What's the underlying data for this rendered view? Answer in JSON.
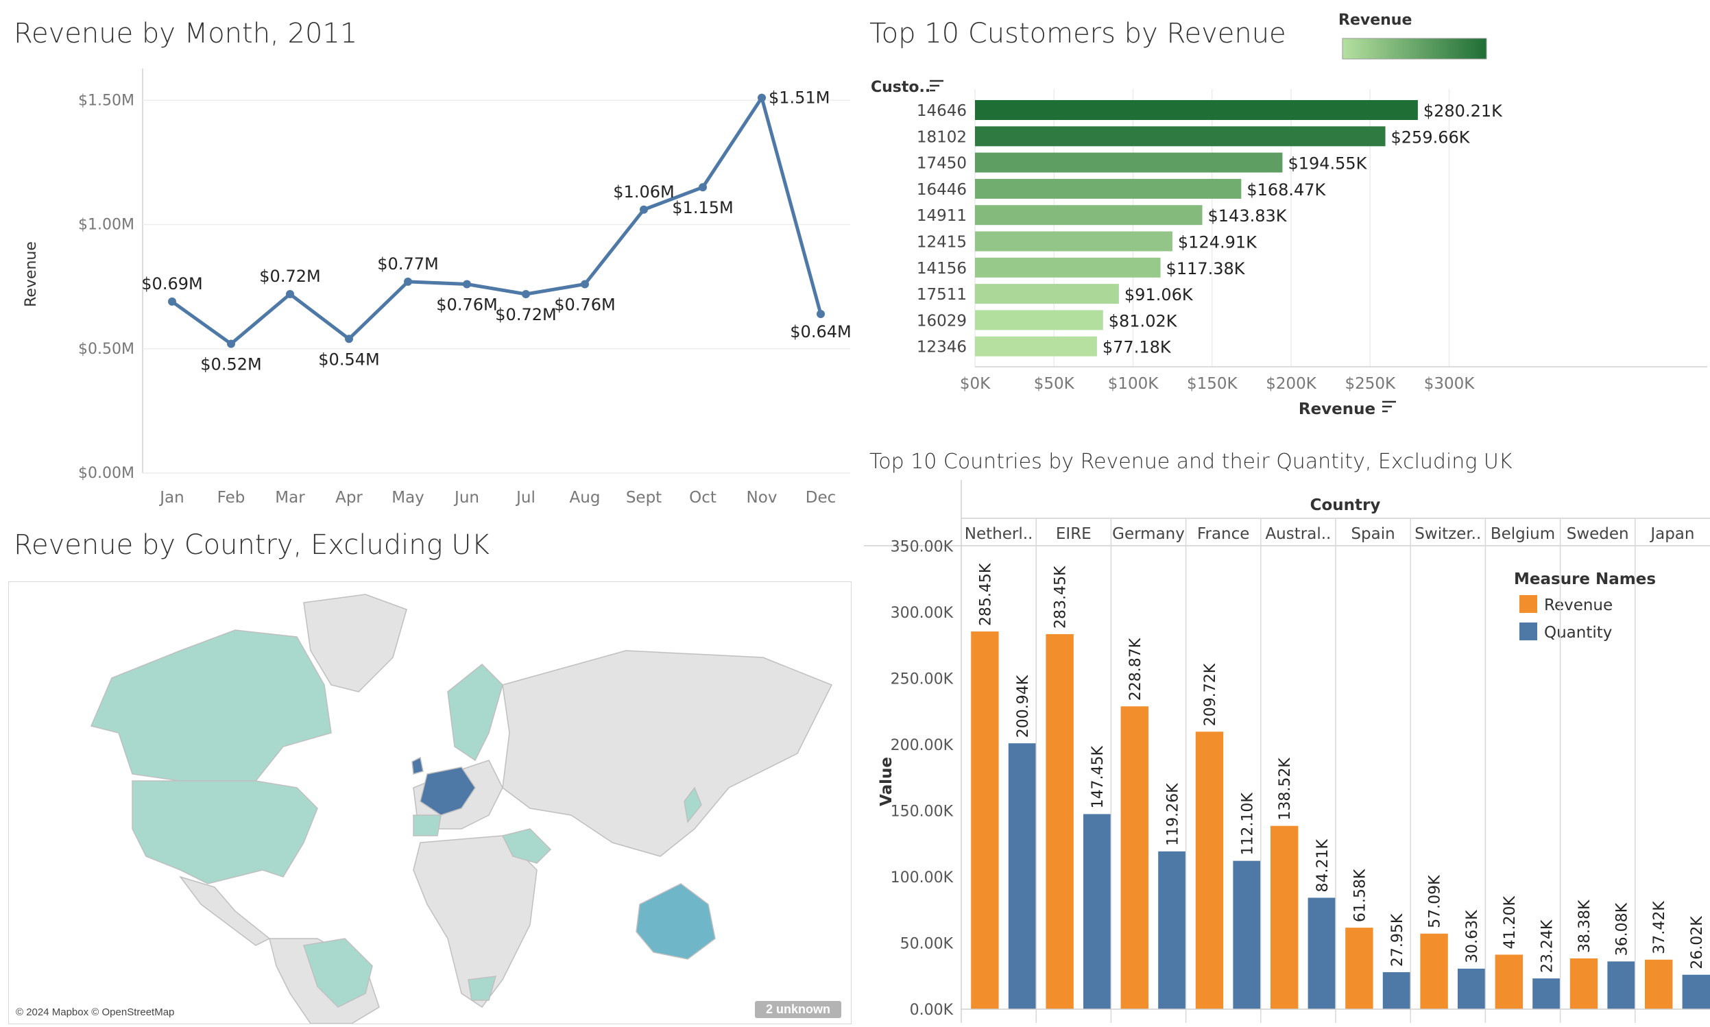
{
  "colors": {
    "line": "#4e79a7",
    "revenue": "#f28e2b",
    "quantity": "#4e79a7",
    "green_low": "#b5e0a0",
    "green_high": "#1f6e35",
    "map_highlight": "#a8d9cc",
    "map_dark": "#4e79a7",
    "map_base": "#e3e3e3"
  },
  "monthly": {
    "title": "Revenue by Month, 2011",
    "ylabel": "Revenue",
    "chart_data": {
      "type": "line",
      "categories": [
        "Jan",
        "Feb",
        "Mar",
        "Apr",
        "May",
        "Jun",
        "Jul",
        "Aug",
        "Sept",
        "Oct",
        "Nov",
        "Dec"
      ],
      "values": [
        0.69,
        0.52,
        0.72,
        0.54,
        0.77,
        0.76,
        0.72,
        0.76,
        1.06,
        1.15,
        1.51,
        0.64
      ],
      "value_labels": [
        "$0.69M",
        "$0.52M",
        "$0.72M",
        "$0.54M",
        "$0.77M",
        "$0.76M",
        "$0.72M",
        "$0.76M",
        "$1.06M",
        "$1.15M",
        "$1.51M",
        "$0.64M"
      ],
      "yticks": [
        0,
        0.5,
        1.0,
        1.5
      ],
      "ytick_labels": [
        "$0.00M",
        "$0.50M",
        "$1.00M",
        "$1.50M"
      ],
      "ylim": [
        0,
        1.6
      ]
    }
  },
  "customers": {
    "title": "Top 10 Customers by Revenue",
    "legend_title": "Revenue",
    "ylabel": "Custo..",
    "xlabel": "Revenue",
    "chart_data": {
      "type": "bar",
      "orientation": "horizontal",
      "categories": [
        "14646",
        "18102",
        "17450",
        "16446",
        "14911",
        "12415",
        "14156",
        "17511",
        "16029",
        "12346"
      ],
      "values": [
        280.21,
        259.66,
        194.55,
        168.47,
        143.83,
        124.91,
        117.38,
        91.06,
        81.02,
        77.18
      ],
      "value_labels": [
        "$280.21K",
        "$259.66K",
        "$194.55K",
        "$168.47K",
        "$143.83K",
        "$124.91K",
        "$117.38K",
        "$91.06K",
        "$81.02K",
        "$77.18K"
      ],
      "xticks": [
        0,
        50,
        100,
        150,
        200,
        250,
        300
      ],
      "xtick_labels": [
        "$0K",
        "$50K",
        "$100K",
        "$150K",
        "$200K",
        "$250K",
        "$300K"
      ],
      "xlim": [
        0,
        330
      ]
    }
  },
  "map": {
    "title": "Revenue by Country, Excluding UK",
    "credit": "© 2024 Mapbox © OpenStreetMap",
    "unknown_badge": "2 unknown"
  },
  "countries": {
    "title": "Top 10 Countries by Revenue and their Quantity, Excluding UK",
    "header": "Country",
    "ylabel": "Value",
    "legend_title": "Measure Names",
    "legend_items": [
      "Revenue",
      "Quantity"
    ],
    "chart_data": {
      "type": "bar",
      "categories": [
        "Netherl..",
        "EIRE",
        "Germany",
        "France",
        "Austral..",
        "Spain",
        "Switzer..",
        "Belgium",
        "Sweden",
        "Japan"
      ],
      "series": [
        {
          "name": "Revenue",
          "values": [
            285.45,
            283.45,
            228.87,
            209.72,
            138.52,
            61.58,
            57.09,
            41.2,
            38.38,
            37.42
          ],
          "labels": [
            "285.45K",
            "283.45K",
            "228.87K",
            "209.72K",
            "138.52K",
            "61.58K",
            "57.09K",
            "41.20K",
            "38.38K",
            "37.42K"
          ]
        },
        {
          "name": "Quantity",
          "values": [
            200.94,
            147.45,
            119.26,
            112.1,
            84.21,
            27.95,
            30.63,
            23.24,
            36.08,
            26.02
          ],
          "labels": [
            "200.94K",
            "147.45K",
            "119.26K",
            "112.10K",
            "84.21K",
            "27.95K",
            "30.63K",
            "23.24K",
            "36.08K",
            "26.02K"
          ]
        }
      ],
      "yticks": [
        0,
        50,
        100,
        150,
        200,
        250,
        300,
        350
      ],
      "ytick_labels": [
        "0.00K",
        "50.00K",
        "100.00K",
        "150.00K",
        "200.00K",
        "250.00K",
        "300.00K",
        "350.00K"
      ],
      "ylim": [
        0,
        350
      ]
    }
  }
}
